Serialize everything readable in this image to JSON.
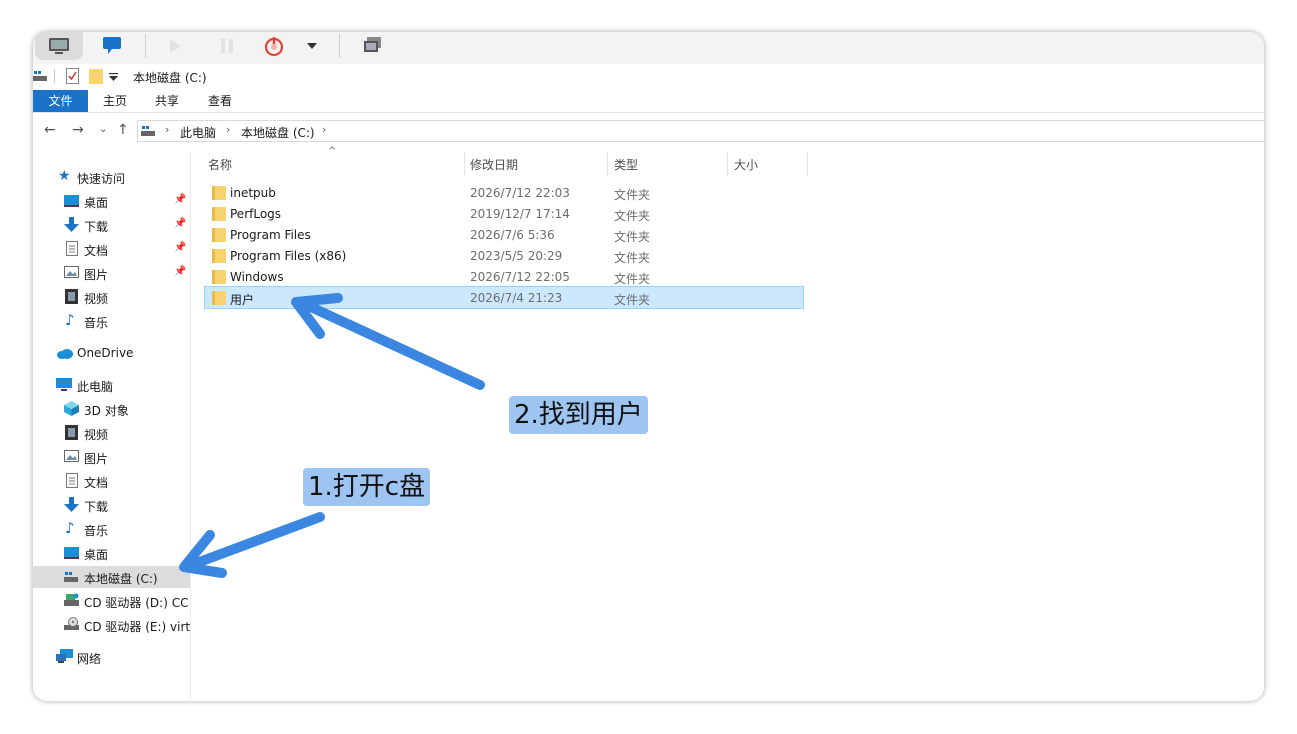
{
  "quick_access_toolbar": {
    "location_text": "本地磁盘 (C:)"
  },
  "ribbon": {
    "tabs": [
      {
        "label": "文件",
        "active": true
      },
      {
        "label": "主页",
        "active": false
      },
      {
        "label": "共享",
        "active": false
      },
      {
        "label": "查看",
        "active": false
      }
    ]
  },
  "address_bar": {
    "breadcrumbs": [
      "此电脑",
      "本地磁盘 (C:)"
    ]
  },
  "sidebar": {
    "quick_access": "快速访问",
    "quick_items": [
      {
        "label": "桌面",
        "icon": "desktop-icon",
        "pinned": true
      },
      {
        "label": "下载",
        "icon": "download-icon",
        "pinned": true
      },
      {
        "label": "文档",
        "icon": "document-icon",
        "pinned": true
      },
      {
        "label": "图片",
        "icon": "picture-icon",
        "pinned": true
      },
      {
        "label": "视频",
        "icon": "video-icon",
        "pinned": false
      },
      {
        "label": "音乐",
        "icon": "music-icon",
        "pinned": false
      }
    ],
    "onedrive": "OneDrive",
    "this_pc": "此电脑",
    "pc_items": [
      {
        "label": "3D 对象",
        "icon": "cube-icon"
      },
      {
        "label": "视频",
        "icon": "video-icon"
      },
      {
        "label": "图片",
        "icon": "picture-icon"
      },
      {
        "label": "文档",
        "icon": "document-icon"
      },
      {
        "label": "下载",
        "icon": "download-icon"
      },
      {
        "label": "音乐",
        "icon": "music-icon"
      },
      {
        "label": "桌面",
        "icon": "desktop-icon"
      },
      {
        "label": "本地磁盘 (C:)",
        "icon": "drive-icon",
        "selected": true
      },
      {
        "label": "CD 驱动器 (D:) CC",
        "icon": "cd-drive-icon"
      },
      {
        "label": "CD 驱动器 (E:) virti",
        "icon": "cd-drive-icon"
      }
    ],
    "network": "网络"
  },
  "file_list": {
    "columns": [
      "名称",
      "修改日期",
      "类型",
      "大小"
    ],
    "rows": [
      {
        "name": "inetpub",
        "date": "2026/7/12 22:03",
        "type": "文件夹",
        "selected": false
      },
      {
        "name": "PerfLogs",
        "date": "2019/12/7 17:14",
        "type": "文件夹",
        "selected": false
      },
      {
        "name": "Program Files",
        "date": "2026/7/6 5:36",
        "type": "文件夹",
        "selected": false
      },
      {
        "name": "Program Files (x86)",
        "date": "2023/5/5 20:29",
        "type": "文件夹",
        "selected": false
      },
      {
        "name": "Windows",
        "date": "2026/7/12 22:05",
        "type": "文件夹",
        "selected": false
      },
      {
        "name": "用户",
        "date": "2026/7/4 21:23",
        "type": "文件夹",
        "selected": true
      }
    ]
  },
  "annotations": {
    "step1": "1.打开c盘",
    "step2": "2.找到用户",
    "arrow_color": "#3a86e0"
  }
}
